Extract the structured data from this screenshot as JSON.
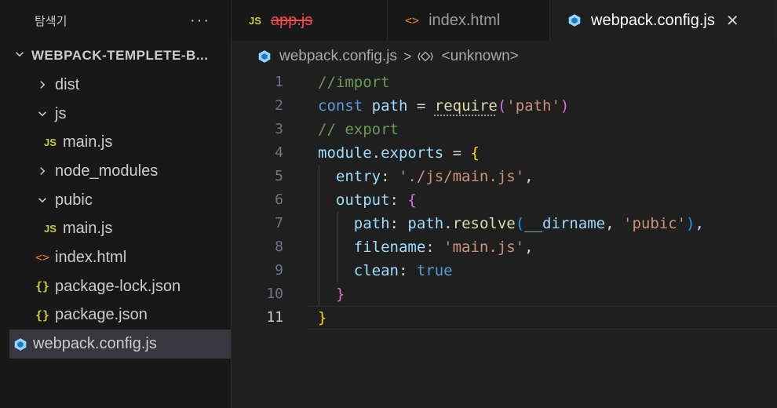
{
  "sidebar": {
    "title": "탐색기",
    "more": "···",
    "folder": "WEBPACK-TEMPLETE-B...",
    "items": [
      {
        "label": "dist",
        "icon": "chevron-right-icon",
        "indent": 1
      },
      {
        "label": "js",
        "icon": "chevron-down-icon",
        "indent": 1
      },
      {
        "label": "main.js",
        "icon": "js-file-icon",
        "indent": 2
      },
      {
        "label": "node_modules",
        "icon": "chevron-right-icon",
        "indent": 1
      },
      {
        "label": "pubic",
        "icon": "chevron-down-icon",
        "indent": 1
      },
      {
        "label": "main.js",
        "icon": "js-file-icon",
        "indent": 2
      },
      {
        "label": "index.html",
        "icon": "html-file-icon",
        "indent": 1
      },
      {
        "label": "package-lock.json",
        "icon": "json-file-icon",
        "indent": 1
      },
      {
        "label": "package.json",
        "icon": "json-file-icon",
        "indent": 1
      },
      {
        "label": "webpack.config.js",
        "icon": "webpack-file-icon",
        "indent": 1,
        "selected": true
      }
    ]
  },
  "tabs": [
    {
      "label": "app.js",
      "icon": "js-file-icon",
      "deleted": true
    },
    {
      "label": "index.html",
      "icon": "html-file-icon"
    },
    {
      "label": "webpack.config.js",
      "icon": "webpack-file-icon",
      "active": true,
      "close": "✕"
    }
  ],
  "breadcrumb": {
    "file": "webpack.config.js",
    "separator": ">",
    "symbol": "<unknown>"
  },
  "editor": {
    "current_line": 11,
    "lines": [
      {
        "n": "1",
        "tokens": [
          [
            "c-comment",
            "//import"
          ]
        ]
      },
      {
        "n": "2",
        "tokens": [
          [
            "c-kw",
            "const"
          ],
          [
            "c-punc",
            " "
          ],
          [
            "c-var",
            "path"
          ],
          [
            "c-punc",
            " = "
          ],
          [
            "c-fn dotted",
            "require"
          ],
          [
            "c-brace2",
            "("
          ],
          [
            "c-str",
            "'path'"
          ],
          [
            "c-brace2",
            ")"
          ]
        ]
      },
      {
        "n": "3",
        "tokens": [
          [
            "c-comment",
            "// export"
          ]
        ]
      },
      {
        "n": "4",
        "tokens": [
          [
            "c-var",
            "module"
          ],
          [
            "c-punc",
            "."
          ],
          [
            "c-var",
            "exports"
          ],
          [
            "c-punc",
            " = "
          ],
          [
            "c-brace1",
            "{"
          ]
        ]
      },
      {
        "n": "5",
        "tokens": [
          [
            "c-punc",
            "  "
          ],
          [
            "c-var",
            "entry"
          ],
          [
            "c-punc",
            ": "
          ],
          [
            "c-str",
            "'./js/main.js'"
          ],
          [
            "c-punc",
            ","
          ]
        ]
      },
      {
        "n": "6",
        "tokens": [
          [
            "c-punc",
            "  "
          ],
          [
            "c-var",
            "output"
          ],
          [
            "c-punc",
            ": "
          ],
          [
            "c-brace2",
            "{"
          ]
        ]
      },
      {
        "n": "7",
        "tokens": [
          [
            "c-punc",
            "    "
          ],
          [
            "c-var",
            "path"
          ],
          [
            "c-punc",
            ": "
          ],
          [
            "c-var",
            "path"
          ],
          [
            "c-punc",
            "."
          ],
          [
            "c-fn",
            "resolve"
          ],
          [
            "c-brace3",
            "("
          ],
          [
            "c-var",
            "__dirname"
          ],
          [
            "c-punc",
            ", "
          ],
          [
            "c-str",
            "'pubic'"
          ],
          [
            "c-brace3",
            ")"
          ],
          [
            "c-punc",
            ","
          ]
        ]
      },
      {
        "n": "8",
        "tokens": [
          [
            "c-punc",
            "    "
          ],
          [
            "c-var",
            "filename"
          ],
          [
            "c-punc",
            ": "
          ],
          [
            "c-str",
            "'main.js'"
          ],
          [
            "c-punc",
            ","
          ]
        ]
      },
      {
        "n": "9",
        "tokens": [
          [
            "c-punc",
            "    "
          ],
          [
            "c-var",
            "clean"
          ],
          [
            "c-punc",
            ": "
          ],
          [
            "c-bool",
            "true"
          ]
        ]
      },
      {
        "n": "10",
        "tokens": [
          [
            "c-punc",
            "  "
          ],
          [
            "c-brace2",
            "}"
          ]
        ]
      },
      {
        "n": "11",
        "tokens": [
          [
            "c-brace1",
            "}"
          ]
        ]
      }
    ]
  },
  "colors": {
    "bg": "#1f1f1f",
    "sidebar_bg": "#181818",
    "selection": "#37373d",
    "js_icon": "#cbcb41",
    "html_icon": "#e37933",
    "webpack_icon": "#8ed6fb"
  }
}
